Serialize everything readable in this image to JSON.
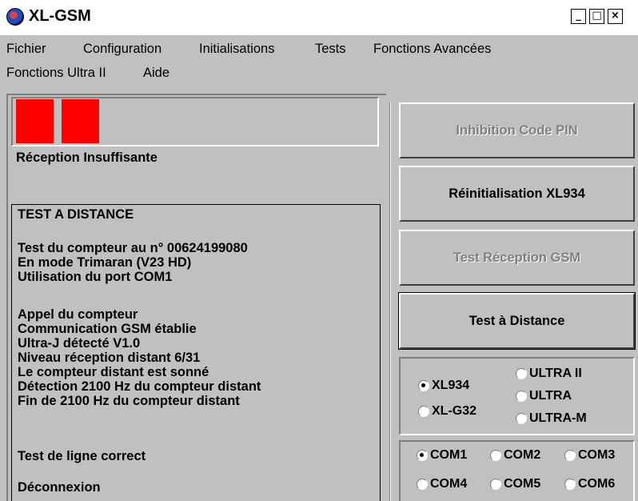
{
  "window": {
    "title": "XL-GSM",
    "minimize": "_",
    "maximize": "□",
    "close": "×"
  },
  "menu": {
    "row1": [
      "Fichier",
      "Configuration",
      "Initialisations",
      "Tests",
      "Fonctions Avancées"
    ],
    "row2": [
      "Fonctions Ultra II",
      "Aide"
    ]
  },
  "signal": {
    "level": "2 bars",
    "bar_color": "#ff0000",
    "label": "Réception Insuffisante"
  },
  "log": {
    "lines": [
      "TEST A DISTANCE",
      "",
      "Test du compteur au n° 00624199080",
      "En mode Trimaran (V23 HD)",
      "Utilisation du port COM1",
      "",
      "Appel du compteur",
      "Communication GSM établie",
      "Ultra-J détecté V1.0",
      "Niveau réception distant 6/31",
      "Le compteur distant est sonné",
      "Détection 2100 Hz du compteur distant",
      "Fin de 2100 Hz du compteur distant",
      "",
      "Test de ligne correct",
      "",
      "Déconnexion"
    ]
  },
  "buttons": {
    "pin": "Inhibition Code PIN",
    "reset": "Réinitialisation XL934",
    "reception": "Test Réception GSM",
    "distance": "Test à Distance"
  },
  "device": {
    "xl934": "XL934",
    "xlg32": "XL-G32",
    "ultra2": "ULTRA II",
    "ultra": "ULTRA",
    "ultram": "ULTRA-M",
    "selected": "XL934"
  },
  "ports": {
    "com1": "COM1",
    "com2": "COM2",
    "com3": "COM3",
    "com4": "COM4",
    "com5": "COM5",
    "com6": "COM6",
    "selected": "COM1"
  }
}
